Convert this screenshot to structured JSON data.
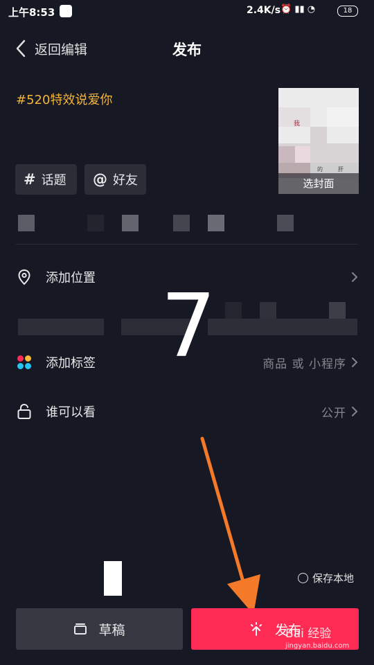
{
  "status_bar": {
    "time": "上午8:53",
    "network_speed": "2.4K/s",
    "battery": "18"
  },
  "header": {
    "back_label": "返回编辑",
    "title": "发布"
  },
  "description": "#520特效说爱你",
  "cover": {
    "button_label": "选封面",
    "thumb_text_1": "我",
    "thumb_text_2": "的",
    "thumb_text_3": "肝"
  },
  "chips": {
    "topic_symbol": "#",
    "topic_label": "话题",
    "friend_symbol": "@",
    "friend_label": "好友"
  },
  "rows": {
    "location_label": "添加位置",
    "tag_label": "添加标签",
    "tag_value": "商品 或 小程序",
    "visibility_label": "谁可以看",
    "visibility_value": "公开"
  },
  "overlay_number": "7",
  "save_local_label": "保存本地",
  "buttons": {
    "draft_label": "草稿",
    "publish_label": "发布"
  },
  "watermark": {
    "brand": "Bai 经验",
    "url": "jingyan.baidu.com"
  },
  "colors": {
    "background": "#161823",
    "accent": "#fe2c55",
    "hashtag": "#f3b53a",
    "annotation_arrow": "#f47a2a"
  }
}
